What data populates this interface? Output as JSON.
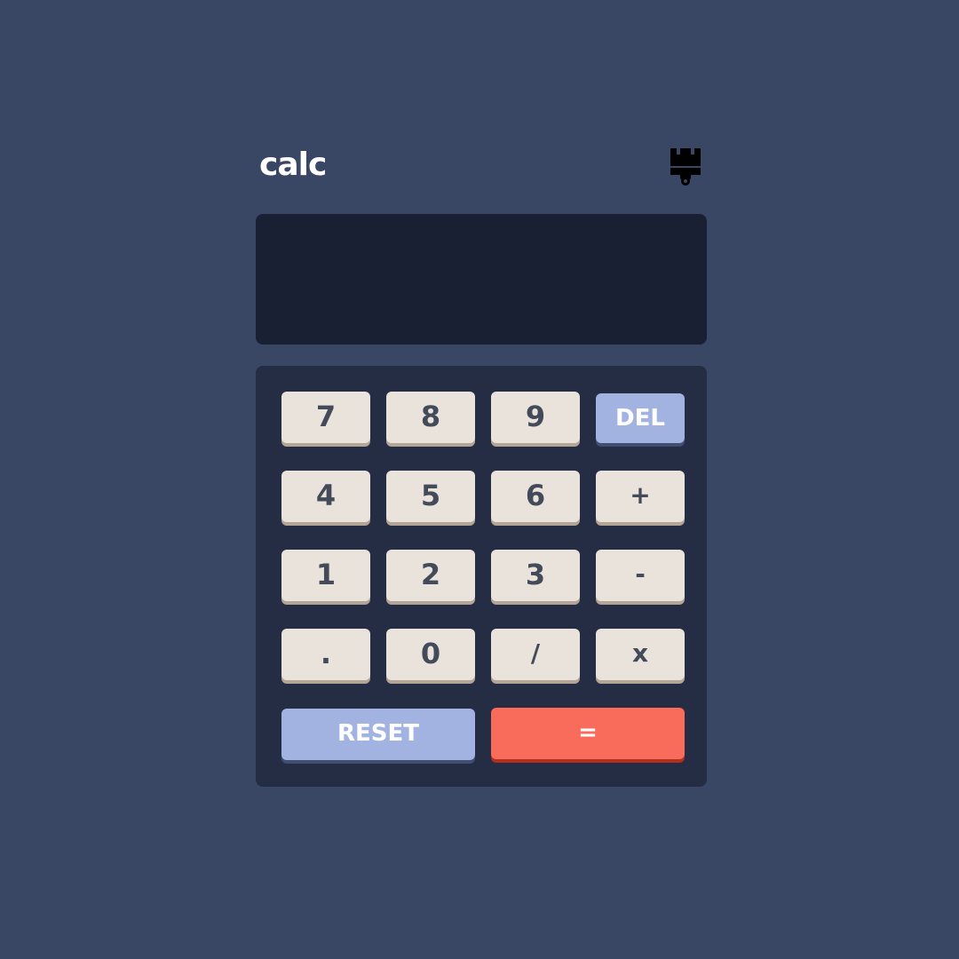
{
  "app": {
    "title": "calc",
    "theme_icon": "paintbrush-icon"
  },
  "display": {
    "value": ""
  },
  "keys": {
    "k7": "7",
    "k8": "8",
    "k9": "9",
    "del": "DEL",
    "k4": "4",
    "k5": "5",
    "k6": "6",
    "plus": "+",
    "k1": "1",
    "k2": "2",
    "k3": "3",
    "minus": "-",
    "dot": ".",
    "k0": "0",
    "divide": "/",
    "multiply": "x",
    "reset": "RESET",
    "equals": "="
  },
  "colors": {
    "background": "#3a4764",
    "screen": "#1a2034",
    "keypad": "#252d45",
    "key": "#eae3dc",
    "key_text": "#434a59",
    "accent_blue": "#a2b3e1",
    "accent_red": "#f96c5b"
  }
}
